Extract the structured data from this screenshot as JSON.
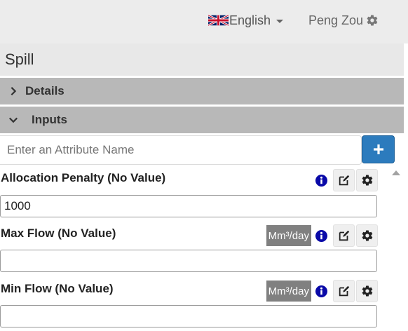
{
  "header": {
    "language": "English",
    "user": "Peng Zou"
  },
  "page": {
    "title": "Spill"
  },
  "sections": [
    {
      "label": "Details",
      "expanded": false
    },
    {
      "label": "Inputs",
      "expanded": true
    }
  ],
  "search": {
    "placeholder": "Enter an Attribute Name",
    "add_icon": "plus-icon"
  },
  "attributes": [
    {
      "label": "Allocation Penalty (No Value)",
      "unit": "",
      "value": "1000"
    },
    {
      "label": "Max Flow (No Value)",
      "unit": "Mm³/day",
      "value": ""
    },
    {
      "label": "Min Flow (No Value)",
      "unit": "Mm³/day",
      "value": ""
    }
  ],
  "colors": {
    "topbar": "#ececec",
    "section": "#b8b8b8",
    "primary": "#2c7bbd",
    "info": "#0a0aa8",
    "unit_badge": "#808080"
  }
}
